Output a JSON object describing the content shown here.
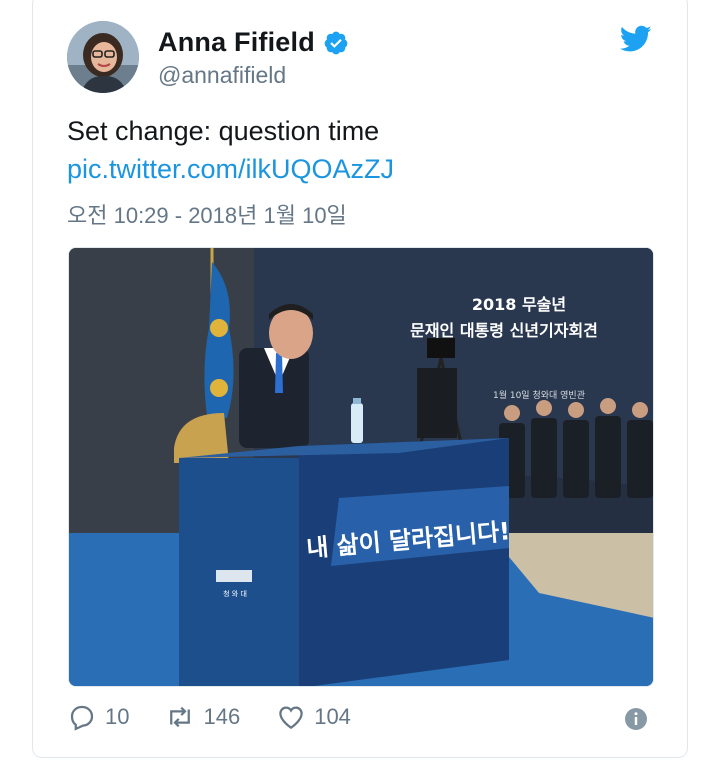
{
  "author": {
    "name": "Anna Fifield",
    "handle": "@annafifield",
    "verified": true
  },
  "tweet": {
    "text": "Set change: question time",
    "link": "pic.twitter.com/ilkUQOAzZJ",
    "timestamp": "오전 10:29 - 2018년 1월 10일"
  },
  "media": {
    "banner_line1": "2018 무술년",
    "banner_line2": "문재인 대통령 신년기자회견",
    "banner_line3": "1월 10일 청와대 영빈관",
    "podium_slogan": "내 삶이 달라집니다!",
    "podium_logo_text": "청 와 대"
  },
  "actions": {
    "reply_count": "10",
    "retweet_count": "146",
    "like_count": "104"
  },
  "colors": {
    "brand": "#1da1f2",
    "link": "#1b95e0",
    "secondary_text": "#657786",
    "border": "#e1e8ed"
  },
  "icons": [
    "verified-badge-icon",
    "twitter-bird-icon",
    "reply-icon",
    "retweet-icon",
    "like-icon",
    "info-icon"
  ]
}
